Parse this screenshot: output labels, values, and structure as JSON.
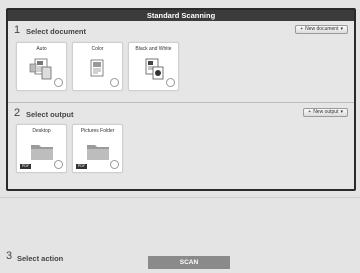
{
  "window": {
    "title": "Standard Scanning"
  },
  "document_section": {
    "number": "1",
    "title": "Select document",
    "new_button": {
      "plus": "+",
      "label": "New document",
      "caret": "▾"
    },
    "tiles": [
      {
        "label": "Auto",
        "icon": "auto-document-icon"
      },
      {
        "label": "Color",
        "icon": "color-document-icon"
      },
      {
        "label": "Black and White",
        "icon": "black-white-document-icon"
      }
    ]
  },
  "output_section": {
    "number": "2",
    "title": "Select output",
    "new_button": {
      "plus": "+",
      "label": "New output",
      "caret": "▾"
    },
    "tiles": [
      {
        "label": "Desktop",
        "icon": "folder-icon",
        "badge": "PDF"
      },
      {
        "label": "Pictures Folder",
        "icon": "folder-icon",
        "badge": "PDF"
      }
    ]
  },
  "action_section": {
    "number": "3",
    "title": "Select action",
    "scan_label": "SCAN"
  }
}
